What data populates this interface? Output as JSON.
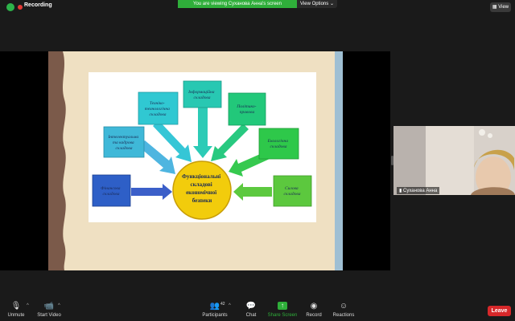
{
  "top_bar": {
    "recording_label": "Recording",
    "viewing_banner": "You are viewing Суханова Анна's screen",
    "view_options_label": "View Options",
    "view_button_label": "View"
  },
  "diagram": {
    "center": [
      "Функціональні",
      "складові",
      "економічної",
      "безпеки"
    ],
    "boxes": [
      {
        "lines": [
          "Фінансова",
          "складова"
        ],
        "color": "#2e5fc7"
      },
      {
        "lines": [
          "Інтелектуальна",
          "та кадрова",
          "складова"
        ],
        "color": "#3fb8d8"
      },
      {
        "lines": [
          "Техніко-",
          "технологічна",
          "складова"
        ],
        "color": "#30c8d2"
      },
      {
        "lines": [
          "Інформаційна",
          "складова"
        ],
        "color": "#28c8b2"
      },
      {
        "lines": [
          "Політико-",
          "правова"
        ],
        "color": "#22c87a"
      },
      {
        "lines": [
          "Екологічна",
          "складова"
        ],
        "color": "#2ec84a"
      },
      {
        "lines": [
          "Силова",
          "складова"
        ],
        "color": "#5cc83e"
      }
    ]
  },
  "participant": {
    "name": "Суханова Анна"
  },
  "toolbar": {
    "unmute_label": "Unmute",
    "start_video_label": "Start Video",
    "participants_label": "Participants",
    "participants_count": "42",
    "chat_label": "Chat",
    "share_screen_label": "Share Screen",
    "record_label": "Record",
    "reactions_label": "Reactions",
    "leave_label": "Leave"
  },
  "colors": {
    "accent_green": "#2fae3a",
    "leave_red": "#d7282a",
    "center_yellow": "#f2cc0c"
  }
}
